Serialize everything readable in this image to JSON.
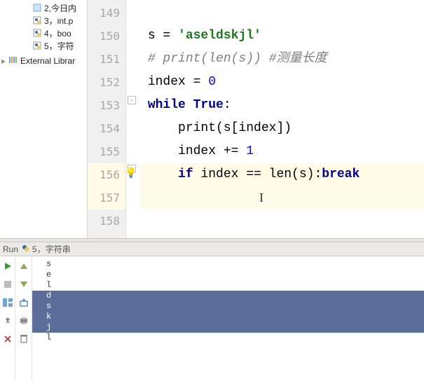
{
  "sidebar": {
    "items": [
      {
        "label": "2,今日内"
      },
      {
        "label": "3，int.p"
      },
      {
        "label": "4，boo"
      },
      {
        "label": "5，字符"
      }
    ],
    "ext_lib": "External Librar"
  },
  "editor": {
    "lines": [
      "149",
      "150",
      "151",
      "152",
      "153",
      "154",
      "155",
      "156",
      "157",
      "158"
    ],
    "code": {
      "l150_pre": "s ",
      "l150_eq": "= ",
      "l150_str": "'aseldskjl'",
      "l151": "# print(len(s)) #测量长度",
      "l152_a": "index ",
      "l152_b": "= ",
      "l152_c": "0",
      "l153_a": "while ",
      "l153_b": "True",
      "l153_c": ":",
      "l154_a": "print",
      "l154_b": "(s[index])",
      "l155_a": "index ",
      "l155_b": "+= ",
      "l155_c": "1",
      "l156_a": "if ",
      "l156_b": "index ",
      "l156_c": "== ",
      "l156_d": "len",
      "l156_e": "(s)",
      "l156_f": ":",
      "l156_g": "break"
    }
  },
  "run": {
    "label": "Run",
    "file": "5，字符串"
  },
  "console": {
    "out": [
      "s",
      "e",
      "l",
      "d",
      "s",
      "k",
      "j",
      "l"
    ]
  }
}
